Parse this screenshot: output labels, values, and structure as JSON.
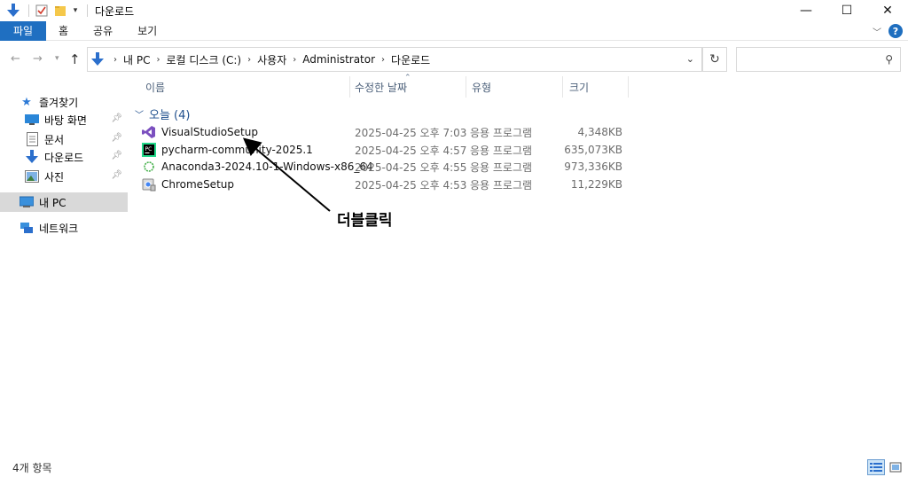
{
  "window": {
    "title": "다운로드"
  },
  "controls": {
    "minimize": "—",
    "maximize": "☐",
    "close": "✕"
  },
  "ribbon": {
    "tabs": [
      "파일",
      "홈",
      "공유",
      "보기"
    ],
    "help": "?"
  },
  "address": {
    "crumbs": [
      "내 PC",
      "로컬 디스크 (C:)",
      "사용자",
      "Administrator",
      "다운로드"
    ]
  },
  "search": {
    "placeholder": ""
  },
  "nav": {
    "quick_access": "즐겨찾기",
    "items": [
      {
        "label": "바탕 화면",
        "icon": "desktop-icon"
      },
      {
        "label": "문서",
        "icon": "documents-icon"
      },
      {
        "label": "다운로드",
        "icon": "downloads-icon"
      },
      {
        "label": "사진",
        "icon": "pictures-icon"
      }
    ],
    "this_pc": "내 PC",
    "network": "네트워크"
  },
  "columns": {
    "name": "이름",
    "date": "수정한 날짜",
    "type": "유형",
    "size": "크기"
  },
  "group": {
    "label": "오늘 (4)"
  },
  "files": [
    {
      "name": "VisualStudioSetup",
      "date": "2025-04-25 오후 7:03",
      "type": "응용 프로그램",
      "size": "4,348KB",
      "icon": "visual-studio-icon"
    },
    {
      "name": "pycharm-community-2025.1",
      "date": "2025-04-25 오후 4:57",
      "type": "응용 프로그램",
      "size": "635,073KB",
      "icon": "pycharm-icon"
    },
    {
      "name": "Anaconda3-2024.10-1-Windows-x86_64",
      "date": "2025-04-25 오후 4:55",
      "type": "응용 프로그램",
      "size": "973,336KB",
      "icon": "anaconda-icon"
    },
    {
      "name": "ChromeSetup",
      "date": "2025-04-25 오후 4:53",
      "type": "응용 프로그램",
      "size": "11,229KB",
      "icon": "chrome-setup-icon"
    }
  ],
  "annotation": {
    "text": "더블클릭"
  },
  "status": {
    "items": "4개 항목"
  }
}
